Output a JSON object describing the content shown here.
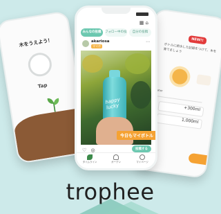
{
  "brand": {
    "logo_text": "trophee"
  },
  "colors": {
    "accent_green": "#6cc8b0",
    "accent_orange": "#f5a233",
    "background": "#cdeaea"
  },
  "left_screen": {
    "title": "木をうえよう！",
    "tap_label": "Tap",
    "icons": [
      "sprout-icon"
    ]
  },
  "center_screen": {
    "status": {
      "time": ""
    },
    "header_icons": "▦ ⌂",
    "tabs": [
      {
        "label": "みんなの投稿"
      },
      {
        "label": "フォロー中の投稿"
      },
      {
        "label": "自分の投稿"
      }
    ],
    "post": {
      "username": "akariosa",
      "tag": "マイボ",
      "bottle_text": "happy lucky",
      "caption": "今日もマイボトル",
      "actions": "♡ ◎",
      "report_label": "投稿する"
    },
    "bottom_nav": [
      {
        "label": "タイムライン",
        "icon": "home-icon"
      },
      {
        "label": "ガーデン",
        "icon": "tree-icon"
      },
      {
        "label": "マイページ",
        "icon": "profile-icon"
      }
    ]
  },
  "right_screen": {
    "badge": "NEW!!",
    "description": "ボトルに給水した記録をつけて、木を育てましょう",
    "select_label": "water",
    "values": [
      "+300ml",
      "1,000ml"
    ]
  }
}
